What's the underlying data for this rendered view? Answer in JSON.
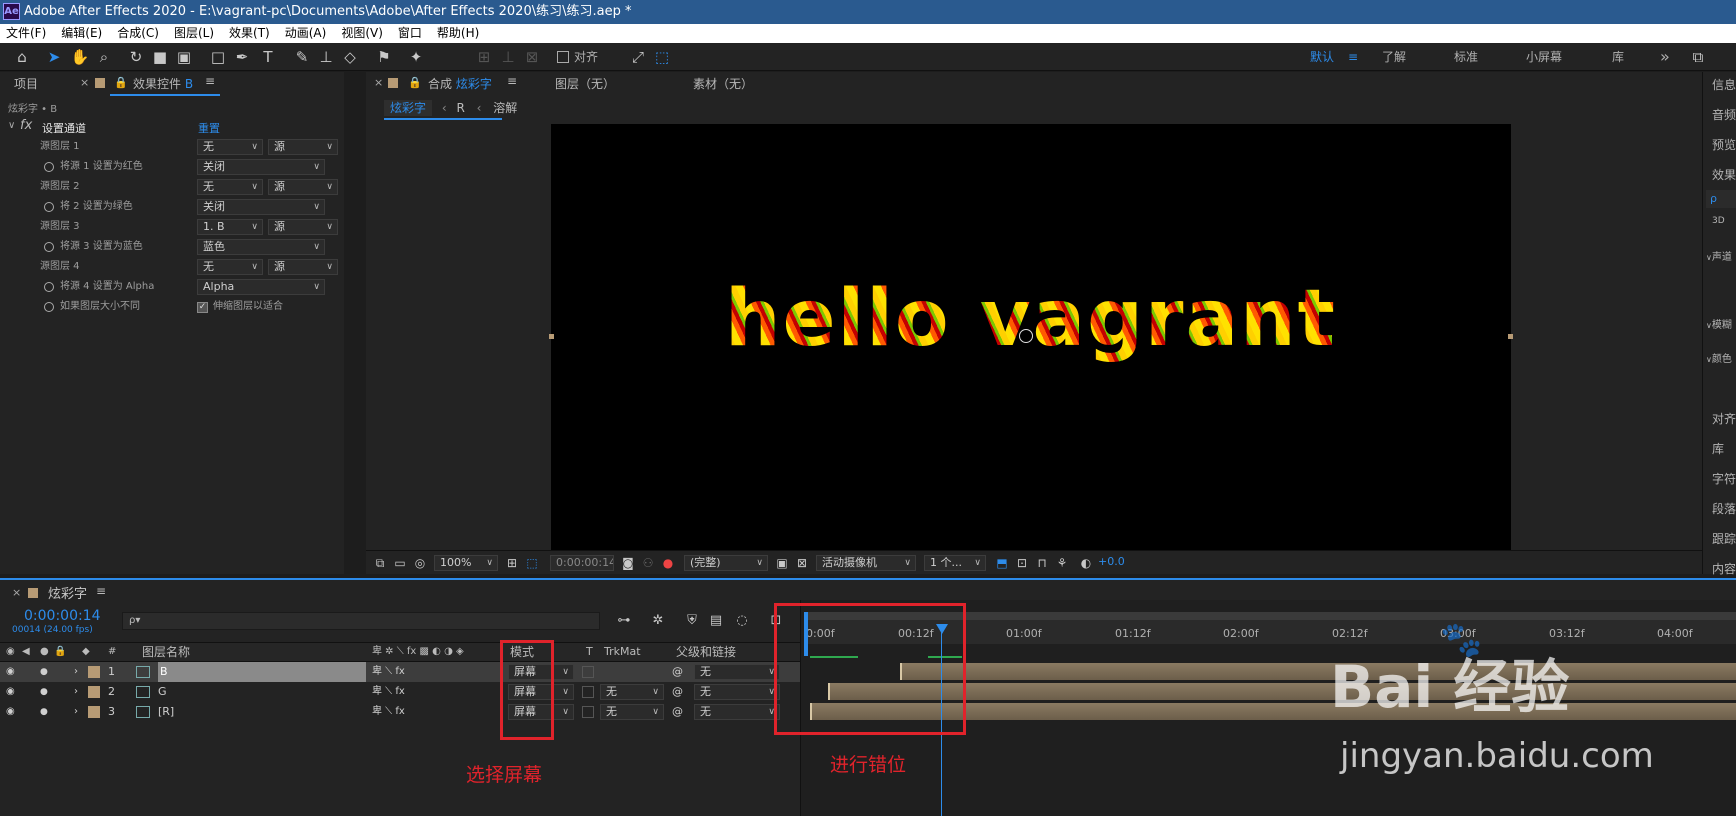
{
  "window": {
    "app_icon": "Ae",
    "title": "Adobe After Effects 2020 - E:\\vagrant-pc\\Documents\\Adobe\\After Effects 2020\\练习\\练习.aep *"
  },
  "menu": [
    "文件(F)",
    "编辑(E)",
    "合成(C)",
    "图层(L)",
    "效果(T)",
    "动画(A)",
    "视图(V)",
    "窗口",
    "帮助(H)"
  ],
  "toolbar": {
    "align_label": "对齐",
    "workspaces": [
      "默认",
      "了解",
      "标准",
      "小屏幕",
      "库"
    ],
    "more": "»"
  },
  "left_panel": {
    "tab_project": "项目",
    "tab_effects_controls": "效果控件",
    "tab_effects_suffix": "B",
    "layer_path": "炫彩字 • B",
    "effect_name": "设置通道",
    "reset": "重置",
    "rows": [
      {
        "label": "源图层 1",
        "v1": "无",
        "v2": "源",
        "kind": "layer"
      },
      {
        "label": "将源 1 设置为红色",
        "v1": "关闭",
        "kind": "chan"
      },
      {
        "label": "源图层 2",
        "v1": "无",
        "v2": "源",
        "kind": "layer"
      },
      {
        "label": "将 2 设置为绿色",
        "v1": "关闭",
        "kind": "chan"
      },
      {
        "label": "源图层 3",
        "v1": "1. B",
        "v2": "源",
        "kind": "layer"
      },
      {
        "label": "将源 3 设置为蓝色",
        "v1": "蓝色",
        "kind": "chan"
      },
      {
        "label": "源图层 4",
        "v1": "无",
        "v2": "源",
        "kind": "layer"
      },
      {
        "label": "将源 4 设置为 Alpha",
        "v1": "Alpha",
        "kind": "chan"
      },
      {
        "label": "如果图层大小不同",
        "check": "伸缩图层以适合",
        "kind": "check"
      }
    ]
  },
  "viewer": {
    "tab_comp": "合成",
    "comp_name": "炫彩字",
    "tab_layer": "图层（无）",
    "tab_footage": "素材（无）",
    "crumbs": [
      "炫彩字",
      "R",
      "溶解"
    ],
    "canvas_text": "hello vagrant",
    "zoom": "100%",
    "timecode": "0:00:00:14",
    "resolution": "(完整)",
    "camera": "活动摄像机",
    "views": "1 个...",
    "exposure": "+0.0"
  },
  "timeline": {
    "comp_name": "炫彩字",
    "timecode": "0:00:00:14",
    "frame_info": "00014 (24.00 fps)",
    "search_placeholder": "ρ▾",
    "col_hash": "#",
    "col_name": "图层名称",
    "col_mode": "模式",
    "col_t": "T",
    "col_trkmat": "TrkMat",
    "col_parent": "父级和链接",
    "layers": [
      {
        "num": "1",
        "name": "B",
        "mode": "屏幕",
        "trk": "",
        "parent": "无"
      },
      {
        "num": "2",
        "name": "G",
        "mode": "屏幕",
        "trk": "无",
        "parent": "无"
      },
      {
        "num": "3",
        "name": "[R]",
        "mode": "屏幕",
        "trk": "无",
        "parent": "无"
      }
    ],
    "ruler": [
      "0:00f",
      "00:12f",
      "01:00f",
      "01:12f",
      "02:00f",
      "02:12f",
      "03:00f",
      "03:12f",
      "04:00f"
    ]
  },
  "right_panel": {
    "items": [
      "信息",
      "音频",
      "预览",
      "效果",
      "3D",
      "声道",
      "模糊",
      "颜色",
      "对齐",
      "库",
      "字符",
      "段落",
      "跟踪",
      "内容"
    ]
  },
  "annotations": {
    "select_screen": "选择屏幕",
    "stagger": "进行错位"
  },
  "watermark": {
    "brand": "Bai 经验",
    "url": "jingyan.baidu.com"
  }
}
